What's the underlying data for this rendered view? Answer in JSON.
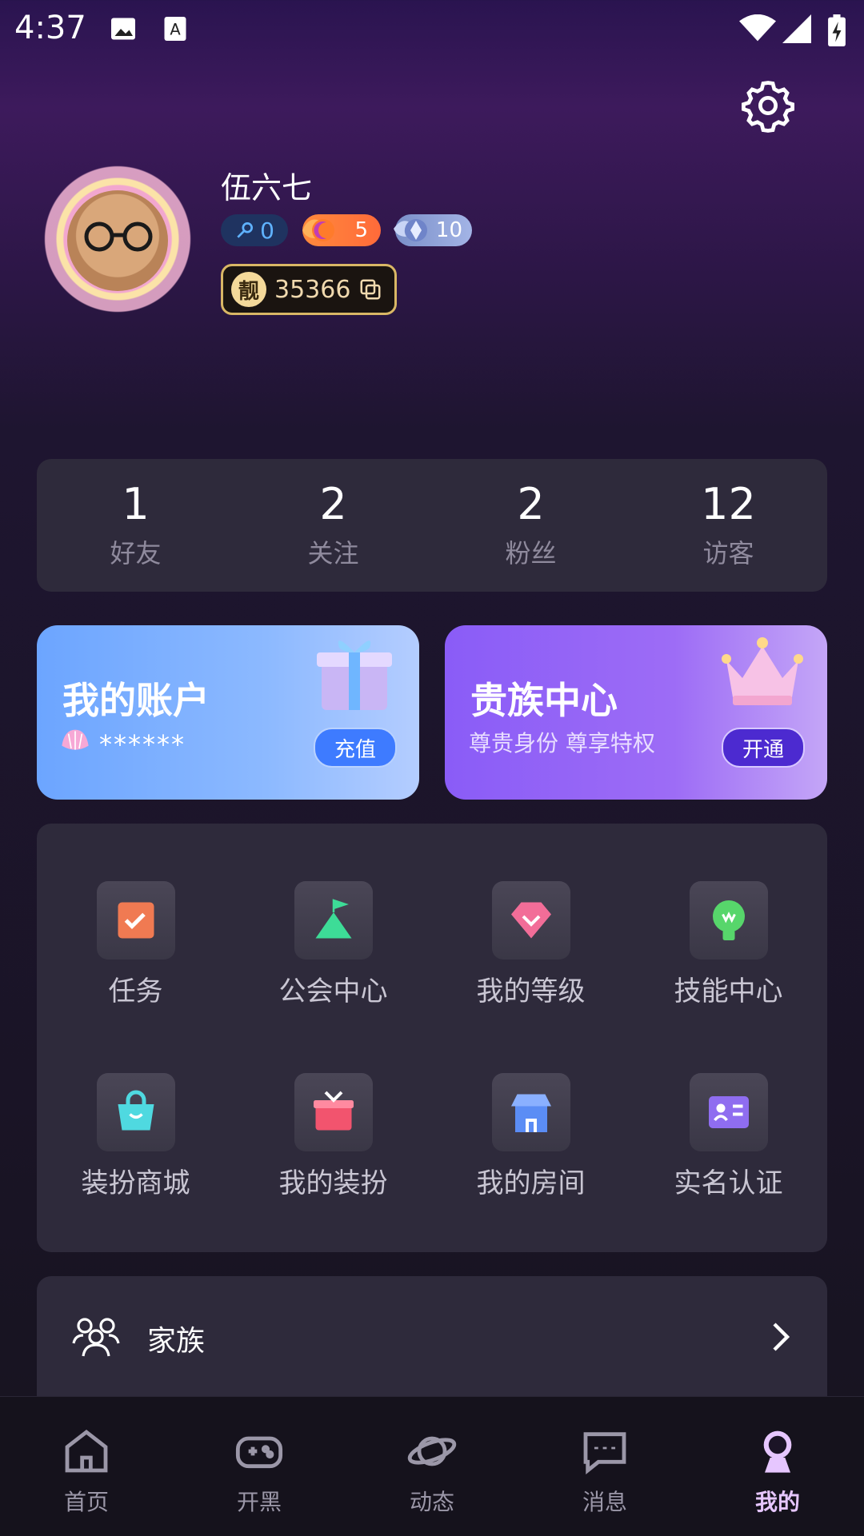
{
  "status": {
    "time": "4:37"
  },
  "profile": {
    "name": "伍六七",
    "badges": {
      "fans": "0",
      "wealth": "5",
      "charm": "10"
    },
    "pretty_id_tag": "靓",
    "id": "35366"
  },
  "stats": [
    {
      "value": "1",
      "label": "好友"
    },
    {
      "value": "2",
      "label": "关注"
    },
    {
      "value": "2",
      "label": "粉丝"
    },
    {
      "value": "12",
      "label": "访客"
    }
  ],
  "account_card": {
    "title": "我的账户",
    "balance": "******",
    "button": "充值"
  },
  "vip_card": {
    "title": "贵族中心",
    "subtitle": "尊贵身份 尊享特权",
    "button": "开通"
  },
  "grid": [
    {
      "label": "任务",
      "icon": "task-icon",
      "color": "#f07a52"
    },
    {
      "label": "公会中心",
      "icon": "guild-flag-icon",
      "color": "#3ddc97"
    },
    {
      "label": "我的等级",
      "icon": "diamond-level-icon",
      "color": "#f26d98"
    },
    {
      "label": "技能中心",
      "icon": "skill-bulb-icon",
      "color": "#57d66b"
    },
    {
      "label": "装扮商城",
      "icon": "shop-bag-icon",
      "color": "#4fd9e0"
    },
    {
      "label": "我的装扮",
      "icon": "dress-gift-icon",
      "color": "#f2546e"
    },
    {
      "label": "我的房间",
      "icon": "room-store-icon",
      "color": "#5b8df5"
    },
    {
      "label": "实名认证",
      "icon": "id-card-icon",
      "color": "#8f6df0"
    }
  ],
  "family": {
    "label": "家族"
  },
  "nav": [
    {
      "label": "首页",
      "icon": "home-icon"
    },
    {
      "label": "开黑",
      "icon": "gamepad-icon"
    },
    {
      "label": "动态",
      "icon": "planet-icon"
    },
    {
      "label": "消息",
      "icon": "message-icon"
    },
    {
      "label": "我的",
      "icon": "profile-icon",
      "active": true
    }
  ]
}
